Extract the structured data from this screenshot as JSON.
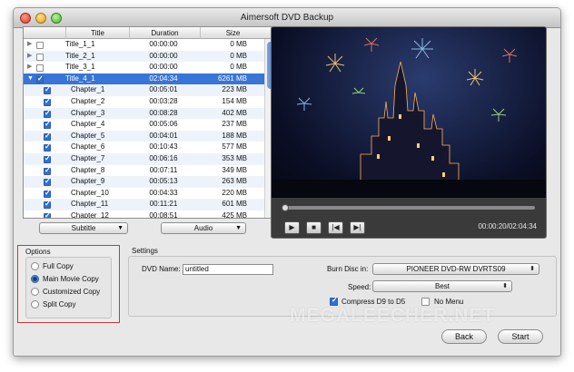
{
  "window": {
    "title": "Aimersoft DVD Backup"
  },
  "list": {
    "columns": {
      "title": "Title",
      "duration": "Duration",
      "size": "Size"
    },
    "titles": [
      {
        "title": "Title_1_1",
        "duration": "00:00:00",
        "size": "0 MB"
      },
      {
        "title": "Title_2_1",
        "duration": "00:00:00",
        "size": "0 MB"
      },
      {
        "title": "Title_3_1",
        "duration": "00:00:00",
        "size": "0 MB"
      },
      {
        "title": "Title_4_1",
        "duration": "02:04:34",
        "size": "6261 MB"
      }
    ],
    "chapters": [
      {
        "title": "Chapter_1",
        "duration": "00:05:01",
        "size": "223 MB"
      },
      {
        "title": "Chapter_2",
        "duration": "00:03:28",
        "size": "154 MB"
      },
      {
        "title": "Chapter_3",
        "duration": "00:08:28",
        "size": "402 MB"
      },
      {
        "title": "Chapter_4",
        "duration": "00:05:06",
        "size": "237 MB"
      },
      {
        "title": "Chapter_5",
        "duration": "00:04:01",
        "size": "188 MB"
      },
      {
        "title": "Chapter_6",
        "duration": "00:10:43",
        "size": "577 MB"
      },
      {
        "title": "Chapter_7",
        "duration": "00:06:16",
        "size": "353 MB"
      },
      {
        "title": "Chapter_8",
        "duration": "00:07:11",
        "size": "349 MB"
      },
      {
        "title": "Chapter_9",
        "duration": "00:05:13",
        "size": "263 MB"
      },
      {
        "title": "Chapter_10",
        "duration": "00:04:33",
        "size": "220 MB"
      },
      {
        "title": "Chapter_11",
        "duration": "00:11:21",
        "size": "601 MB"
      },
      {
        "title": "Chapter_12",
        "duration": "00:08:51",
        "size": "425 MB"
      }
    ],
    "subtitle_label": "Subtitle",
    "audio_label": "Audio"
  },
  "preview": {
    "timecode": "00:00:20/02:04:34",
    "play_icon": "play-icon",
    "stop_icon": "stop-icon",
    "prev_icon": "previous-icon",
    "next_icon": "next-icon"
  },
  "options": {
    "title": "Options",
    "items": [
      "Full Copy",
      "Main Movie Copy",
      "Customized Copy",
      "Split Copy"
    ],
    "selected": "Main Movie Copy"
  },
  "settings": {
    "title": "Settings",
    "dvd_name_label": "DVD Name:",
    "dvd_name_value": "untitled",
    "burn_label": "Burn Disc in:",
    "burn_value": "PIONEER DVD-RW DVRTS09",
    "speed_label": "Speed:",
    "speed_value": "Best",
    "compress_label": "Compress D9 to D5",
    "compress_checked": true,
    "nomenu_label": "No Menu",
    "nomenu_checked": false
  },
  "watermark": "MEGALEECHER.NET",
  "buttons": {
    "back": "Back",
    "start": "Start"
  },
  "colors": {
    "selection": "#3875d7",
    "options_border": "#c43a3a"
  }
}
